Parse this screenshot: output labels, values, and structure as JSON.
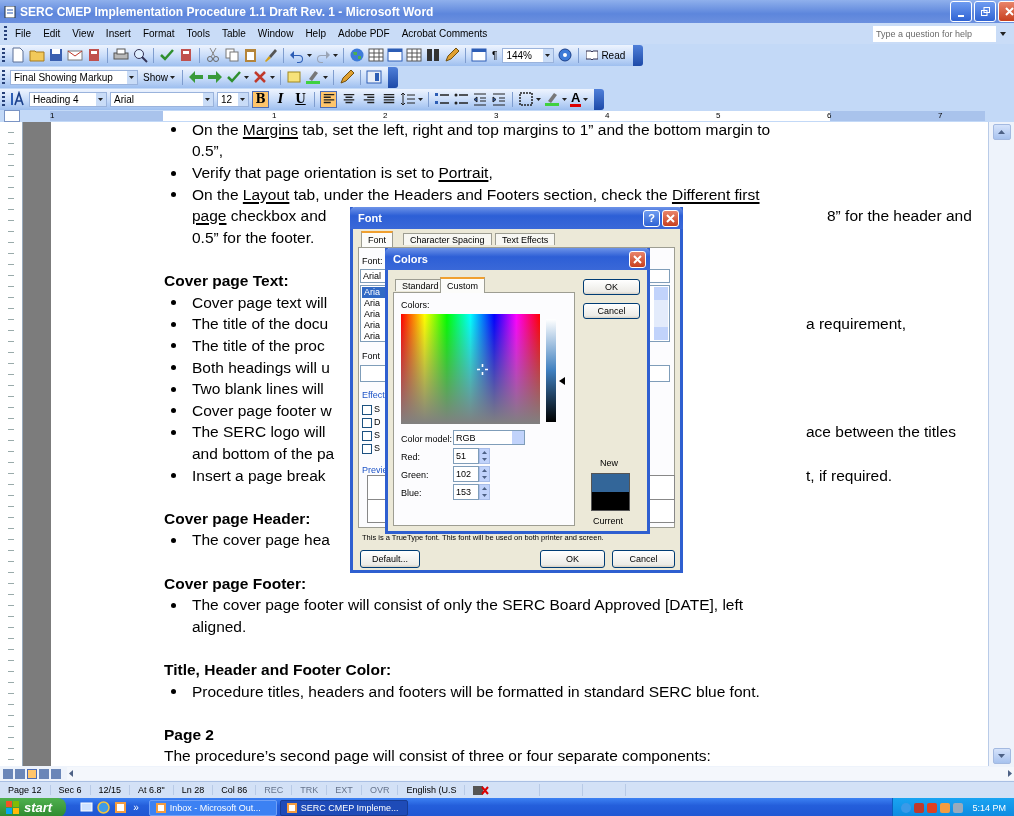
{
  "window": {
    "title": "SERC CMEP Implementation Procedure 1.1 Draft Rev. 1 - Microsoft Word",
    "help_placeholder": "Type a question for help"
  },
  "menu": [
    "File",
    "Edit",
    "View",
    "Insert",
    "Format",
    "Tools",
    "Table",
    "Window",
    "Help",
    "Adobe PDF",
    "Acrobat Comments"
  ],
  "standard_toolbar": {
    "pilcrow": "¶",
    "zoom": "144%",
    "read": "Read"
  },
  "reviewing_toolbar": {
    "display": "Final Showing Markup",
    "show": "Show"
  },
  "formatting_toolbar": {
    "style": "Heading 4",
    "font": "Arial",
    "size": "12",
    "buttons": [
      {
        "label": "B",
        "kind": "bold",
        "selected": true
      },
      {
        "label": "I",
        "kind": "italic",
        "selected": false
      },
      {
        "label": "U",
        "kind": "underline",
        "selected": false
      }
    ],
    "align": [
      {
        "kind": "left",
        "selected": true
      },
      {
        "kind": "center",
        "selected": false
      },
      {
        "kind": "right",
        "selected": false
      },
      {
        "kind": "justify",
        "selected": false
      }
    ],
    "font_color": "A"
  },
  "ruler": [
    "1",
    "1",
    "2",
    "3",
    "4",
    "5",
    "6",
    "7"
  ],
  "document": {
    "lines": [
      {
        "kind": "bullet",
        "parts": [
          {
            "text": "On the ",
            "underline": false
          },
          {
            "text": "Margins",
            "underline": true
          },
          {
            "text": " tab, set the left, right and top margins to 1” and the bottom margin to",
            "underline": false
          }
        ]
      },
      {
        "kind": "cont",
        "parts": [
          {
            "text": "0.5”,",
            "underline": false
          }
        ]
      },
      {
        "kind": "bullet",
        "parts": [
          {
            "text": "Verify that page orientation is set to ",
            "underline": false
          },
          {
            "text": "Portrait",
            "underline": true
          },
          {
            "text": ",",
            "underline": false
          }
        ]
      },
      {
        "kind": "bullet",
        "parts": [
          {
            "text": "On the ",
            "underline": false
          },
          {
            "text": "Layout",
            "underline": true
          },
          {
            "text": " tab, under the Headers and Footers section, check the ",
            "underline": false
          },
          {
            "text": "Different first",
            "underline": true
          }
        ]
      },
      {
        "kind": "cont",
        "parts": [
          {
            "text": "page",
            "underline": true
          },
          {
            "text": " checkbox and",
            "underline": false
          }
        ],
        "right": "8” for the header and"
      },
      {
        "kind": "cont",
        "parts": [
          {
            "text": "0.5” for the footer.",
            "underline": false
          }
        ]
      },
      {
        "kind": "blank"
      },
      {
        "kind": "heading",
        "parts": [
          {
            "text": "Cover page Text:",
            "underline": false
          }
        ]
      },
      {
        "kind": "bullet",
        "parts": [
          {
            "text": "Cover page text will",
            "underline": false
          }
        ]
      },
      {
        "kind": "bullet",
        "parts": [
          {
            "text": "The title of the docu",
            "underline": false
          }
        ],
        "right": "a requirement,"
      },
      {
        "kind": "bullet",
        "parts": [
          {
            "text": "The title of the proc",
            "underline": false
          }
        ]
      },
      {
        "kind": "bullet",
        "parts": [
          {
            "text": "Both headings will u",
            "underline": false
          }
        ]
      },
      {
        "kind": "bullet",
        "parts": [
          {
            "text": "Two blank lines will",
            "underline": false
          }
        ]
      },
      {
        "kind": "bullet",
        "parts": [
          {
            "text": "Cover page footer w",
            "underline": false
          }
        ]
      },
      {
        "kind": "bullet",
        "parts": [
          {
            "text": "The SERC logo will",
            "underline": false
          }
        ],
        "right": "ace between the titles"
      },
      {
        "kind": "cont",
        "parts": [
          {
            "text": "and bottom of the pa",
            "underline": false
          }
        ]
      },
      {
        "kind": "bullet",
        "parts": [
          {
            "text": "Insert a page break",
            "underline": false
          }
        ],
        "right": "t, if required."
      },
      {
        "kind": "blank"
      },
      {
        "kind": "heading",
        "parts": [
          {
            "text": "Cover page Header:",
            "underline": false
          }
        ]
      },
      {
        "kind": "bullet",
        "parts": [
          {
            "text": "The cover page hea",
            "underline": false
          }
        ]
      },
      {
        "kind": "blank"
      },
      {
        "kind": "heading",
        "parts": [
          {
            "text": "Cover page Footer:",
            "underline": false
          }
        ]
      },
      {
        "kind": "bullet",
        "parts": [
          {
            "text": "The cover page footer will consist of only the SERC Board Approved [DATE], left",
            "underline": false
          }
        ]
      },
      {
        "kind": "cont",
        "parts": [
          {
            "text": "aligned.",
            "underline": false
          }
        ]
      },
      {
        "kind": "blank"
      },
      {
        "kind": "heading",
        "parts": [
          {
            "text": "Title, Header and Footer Color:",
            "underline": false
          }
        ]
      },
      {
        "kind": "bullet",
        "parts": [
          {
            "text": "Procedure titles, headers and footers will be formatted in standard SERC blue font.",
            "underline": false
          }
        ]
      },
      {
        "kind": "blank"
      },
      {
        "kind": "heading",
        "parts": [
          {
            "text": "Page 2",
            "underline": false
          }
        ]
      },
      {
        "kind": "para",
        "parts": [
          {
            "text": "The procedure’s second page will consist of three or four separate components:",
            "underline": false
          }
        ]
      }
    ]
  },
  "font_dialog": {
    "title": "Font",
    "help": "?",
    "tabs": [
      {
        "label": "Font",
        "selected": true
      },
      {
        "label": "Character Spacing",
        "selected": false
      },
      {
        "label": "Text Effects",
        "selected": false
      }
    ],
    "font_label": "Font:",
    "font_value": "Arial",
    "font_list": [
      {
        "label": "Aria",
        "selected": true
      },
      {
        "label": "Aria",
        "selected": false
      },
      {
        "label": "Aria",
        "selected": false
      },
      {
        "label": "Aria",
        "selected": false
      },
      {
        "label": "Aria",
        "selected": false
      }
    ],
    "style_label": "Font",
    "effects_label": "Effect",
    "effects": [
      {
        "label": "S",
        "checked": false
      },
      {
        "label": "D",
        "checked": false
      },
      {
        "label": "S",
        "checked": false
      },
      {
        "label": "S",
        "checked": false
      }
    ],
    "preview_label": "Previe",
    "preview_caption": "This is a TrueType font. This font will be used on both printer and screen.",
    "buttons": [
      "Default...",
      "OK",
      "Cancel"
    ]
  },
  "colors_dialog": {
    "title": "Colors",
    "tabs": [
      {
        "label": "Standard",
        "selected": false
      },
      {
        "label": "Custom",
        "selected": true
      }
    ],
    "colors_label": "Colors:",
    "model_label": "Color model:",
    "model": "RGB",
    "channels": [
      {
        "label": "Red:",
        "value": "51"
      },
      {
        "label": "Green:",
        "value": "102"
      },
      {
        "label": "Blue:",
        "value": "153"
      }
    ],
    "buttons": [
      "OK",
      "Cancel"
    ],
    "new_label": "New",
    "current_label": "Current"
  },
  "status_bar": {
    "fields": [
      {
        "text": "Page 12",
        "disabled": false
      },
      {
        "text": "Sec 6",
        "disabled": false
      },
      {
        "text": "12/15",
        "disabled": false
      },
      {
        "text": "At 6.8\"",
        "disabled": false
      },
      {
        "text": "Ln 28",
        "disabled": false
      },
      {
        "text": "Col 86",
        "disabled": false
      },
      {
        "text": "REC",
        "disabled": true
      },
      {
        "text": "TRK",
        "disabled": true
      },
      {
        "text": "EXT",
        "disabled": true
      },
      {
        "text": "OVR",
        "disabled": true
      },
      {
        "text": "English (U.S",
        "disabled": false
      }
    ]
  },
  "taskbar": {
    "start": "start",
    "overflow": "»",
    "tasks": [
      {
        "label": "Inbox - Microsoft Out...",
        "selected": false
      },
      {
        "label": "SERC CMEP Impleme...",
        "selected": true
      }
    ],
    "clock": "5:14 PM"
  }
}
